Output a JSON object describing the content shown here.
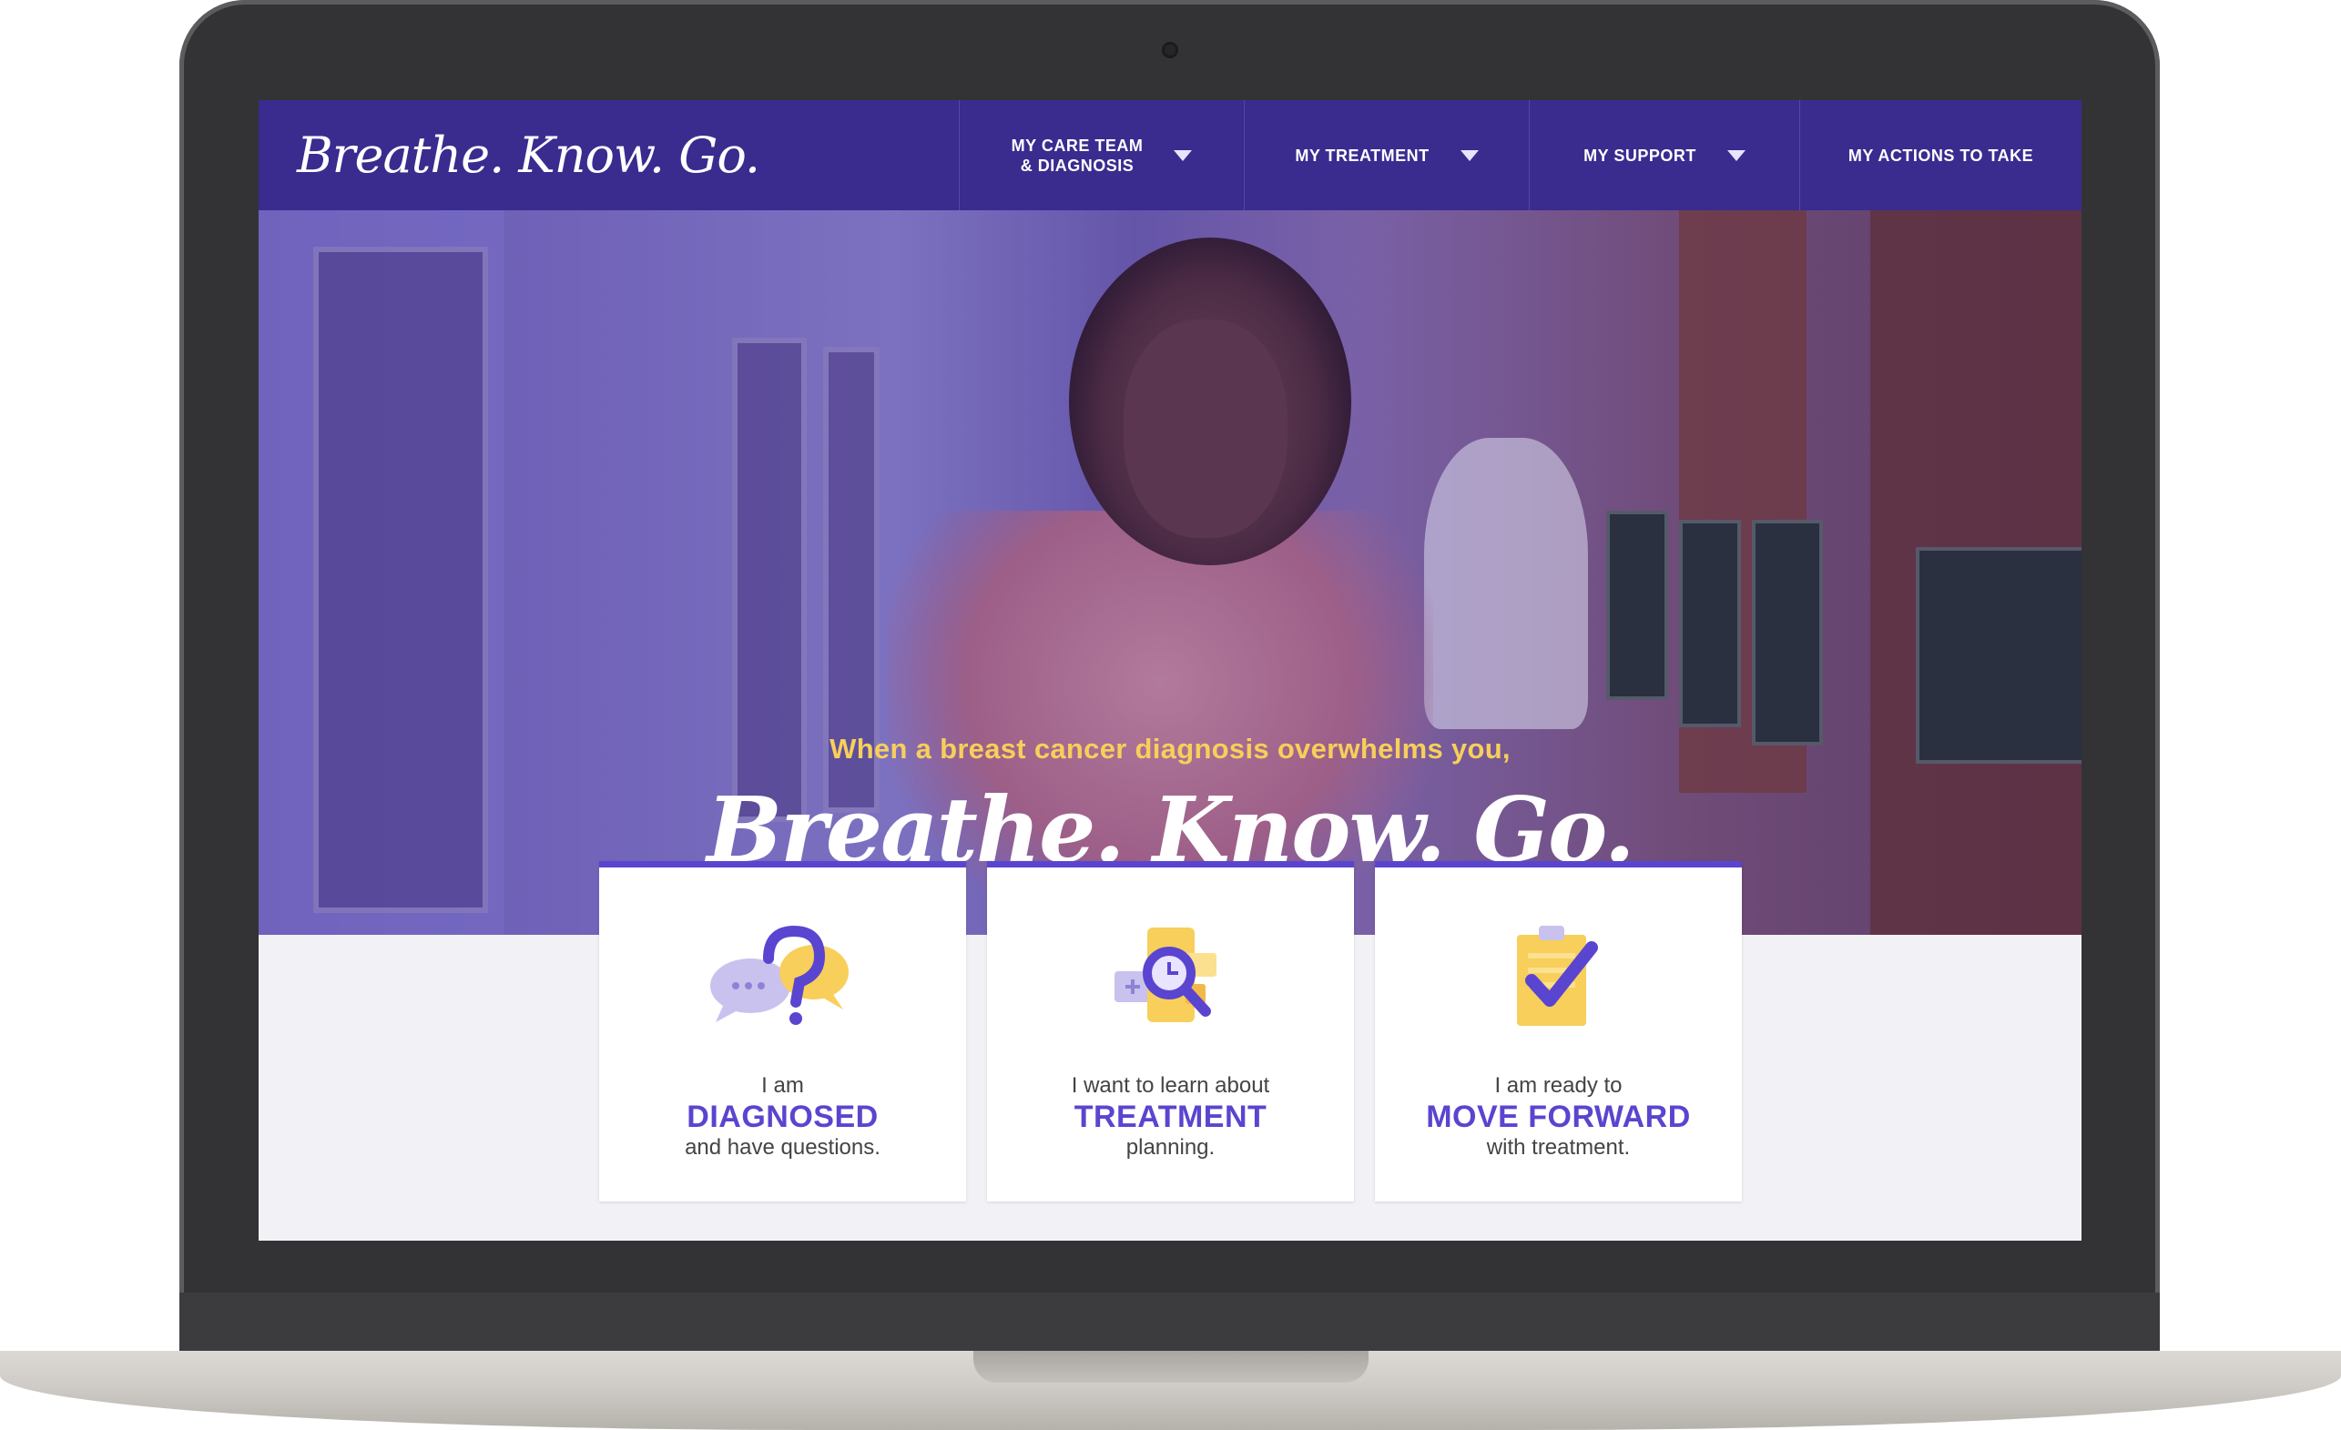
{
  "nav": {
    "logo": "Breathe. Know. Go.",
    "items": [
      {
        "label_line1": "MY CARE TEAM",
        "label_line2": "& DIAGNOSIS"
      },
      {
        "label": "MY TREATMENT"
      },
      {
        "label": "MY SUPPORT"
      },
      {
        "label": "MY ACTIONS TO TAKE"
      }
    ]
  },
  "hero": {
    "tagline": "When a breast cancer diagnosis overwhelms you,",
    "title": "Breathe. Know. Go."
  },
  "cards": [
    {
      "line1": "I am",
      "line2": "DIAGNOSED",
      "line3": "and have questions.",
      "icon": "question-bubbles-icon"
    },
    {
      "line1": "I want to learn about",
      "line2": "TREATMENT",
      "line3": "planning.",
      "icon": "magnifier-phone-icon"
    },
    {
      "line1": "I am ready to",
      "line2": "MOVE FORWARD",
      "line3": "with treatment.",
      "icon": "clipboard-check-icon"
    }
  ],
  "colors": {
    "nav_bg": "#3a2b8f",
    "accent": "#5a45d0",
    "tagline": "#f7cf5a",
    "page_bg": "#f2f1f6"
  }
}
